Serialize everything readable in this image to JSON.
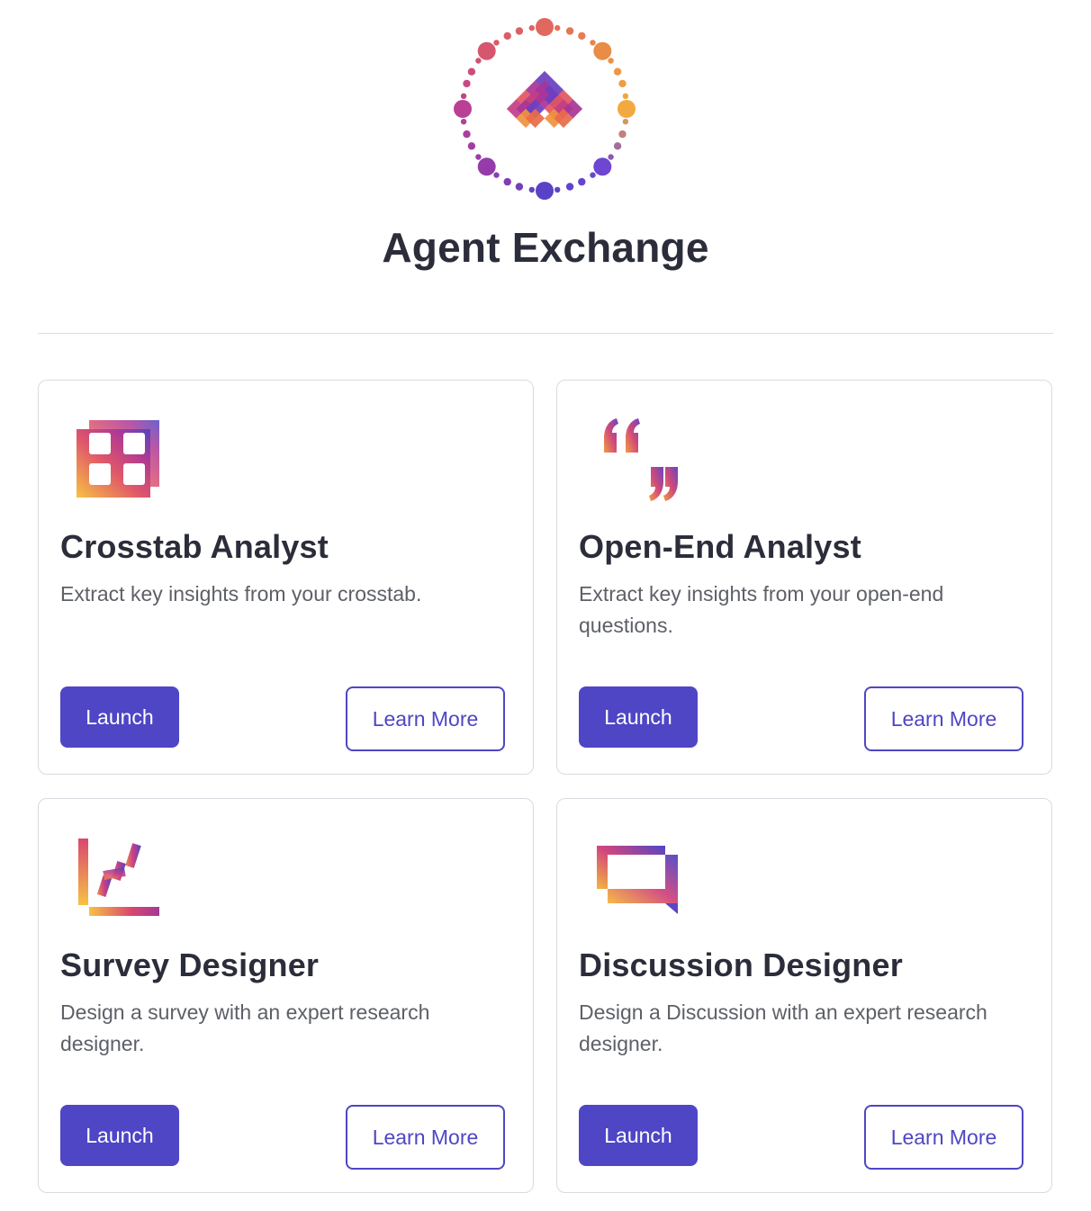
{
  "app": {
    "title": "Agent Exchange",
    "logo_icon": "agent-exchange-logo-icon"
  },
  "colors": {
    "accent": "#4e46c5",
    "title_text": "#2b2d3a",
    "body_text": "#5e6068",
    "gradient": [
      "#f5b63e",
      "#e2595a",
      "#b23b8e",
      "#4e46c5"
    ]
  },
  "cards": [
    {
      "title": "Crosstab Analyst",
      "description": "Extract key insights from your crosstab.",
      "icon": "crosstab-grid-icon",
      "launch_label": "Launch",
      "learn_more_label": "Learn More"
    },
    {
      "title": "Open-End Analyst",
      "description": "Extract key insights from your open-end questions.",
      "icon": "quote-marks-icon",
      "launch_label": "Launch",
      "learn_more_label": "Learn More"
    },
    {
      "title": "Survey Designer",
      "description": "Design a survey with an expert research designer.",
      "icon": "trend-chart-icon",
      "launch_label": "Launch",
      "learn_more_label": "Learn More"
    },
    {
      "title": "Discussion Designer",
      "description": "Design a Discussion with an expert research designer.",
      "icon": "chat-bubble-icon",
      "launch_label": "Launch",
      "learn_more_label": "Learn More"
    }
  ]
}
